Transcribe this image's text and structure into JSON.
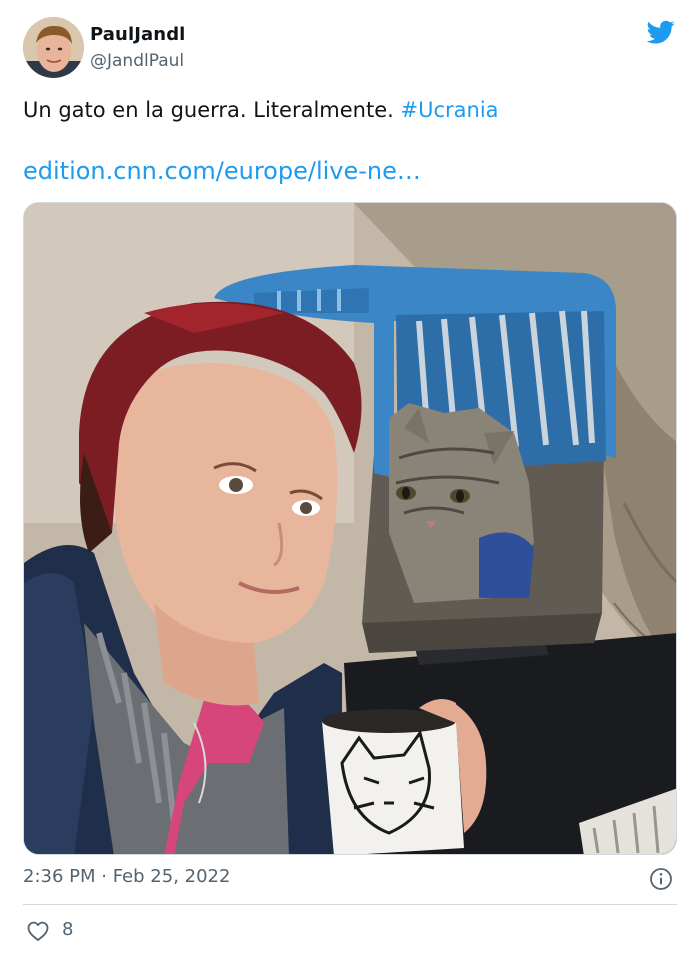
{
  "tweet": {
    "display_name": "PaulJandl",
    "handle": "@JandlPaul",
    "text": "Un gato en la guerra. Literalmente.",
    "hashtag": "#Ucrania",
    "link": "edition.cnn.com/europe/live-ne…",
    "timestamp": "2:36 PM · Feb 25, 2022",
    "like_count": "8"
  },
  "icons": {
    "brand": "twitter-bird-icon",
    "info": "info-icon",
    "like": "heart-icon"
  },
  "colors": {
    "brand_blue": "#1d9bf0",
    "text_primary": "#0f1419",
    "text_secondary": "#536471",
    "divider": "#cfd9de"
  }
}
